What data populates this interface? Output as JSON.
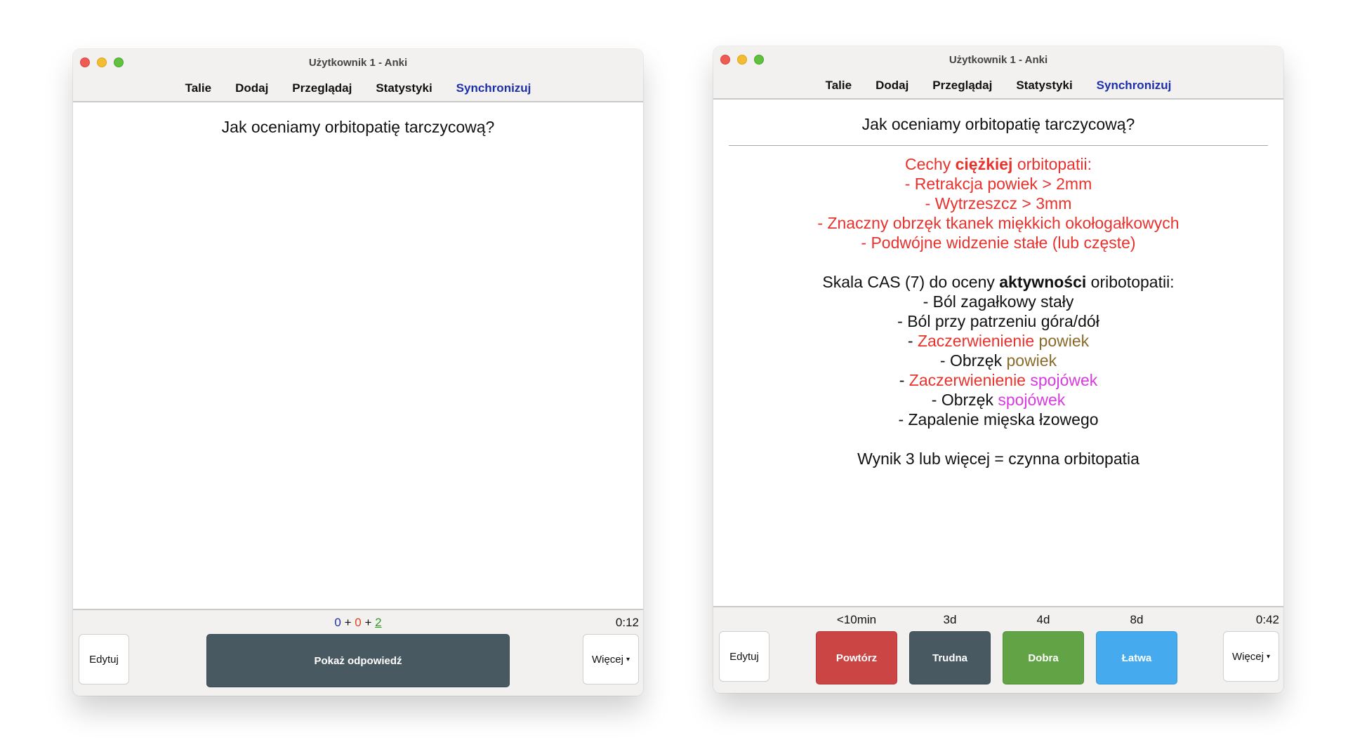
{
  "window_title": "Użytkownik 1 - Anki",
  "menu": {
    "decks": "Talie",
    "add": "Dodaj",
    "browse": "Przeglądaj",
    "stats": "Statystyki",
    "sync": "Synchronizuj"
  },
  "question": "Jak oceniamy orbitopatię tarczycową?",
  "left": {
    "timer": "0:12",
    "counts": {
      "new": "0",
      "learning": "0",
      "review": "2",
      "plus": "+"
    },
    "edit_label": "Edytuj",
    "show_answer_label": "Pokaż odpowiedź",
    "more_label": "Więcej"
  },
  "right": {
    "timer": "0:42",
    "edit_label": "Edytuj",
    "more_label": "Więcej",
    "ease": [
      {
        "interval": "<10min",
        "label": "Powtórz"
      },
      {
        "interval": "3d",
        "label": "Trudna"
      },
      {
        "interval": "4d",
        "label": "Dobra"
      },
      {
        "interval": "8d",
        "label": "Łatwa"
      }
    ]
  },
  "answer": {
    "severe_pre": "Cechy ",
    "severe_bold": "ciężkiej",
    "severe_post": " orbitopatii:",
    "severe_items": [
      "- Retrakcja powiek > 2mm",
      "- Wytrzeszcz > 3mm",
      "- Znaczny obrzęk tkanek miękkich okołogałkowych",
      "- Podwójne widzenie stałe (lub częste)"
    ],
    "cas_pre": "Skala CAS (7) do oceny ",
    "cas_bold": "aktywności",
    "cas_post": " oribotopatii:",
    "cas_1": "- Ból zagałkowy stały",
    "cas_2": "- Ból przy patrzeniu góra/dół",
    "cas_3_dash": "- ",
    "cas_3_a": "Zaczerwienienie",
    "cas_3_b": " powiek",
    "cas_4_a": "- Obrzęk ",
    "cas_4_b": "powiek",
    "cas_5_dash": "- ",
    "cas_5_a": "Zaczerwienienie",
    "cas_5_b": " spojówek",
    "cas_6_a": "- Obrzęk ",
    "cas_6_b": "spojówek",
    "cas_7": "- Zapalenie mięska łzowego",
    "result": "Wynik 3 lub więcej = czynna orbitopatia"
  },
  "colors": {
    "red_text": "#e8322d",
    "brown_text": "#8a6a2a",
    "pink_text": "#d63ae0",
    "again_button": "#ca4543",
    "hard_button": "#485961",
    "good_button": "#62a346",
    "easy_button": "#45aaee"
  }
}
